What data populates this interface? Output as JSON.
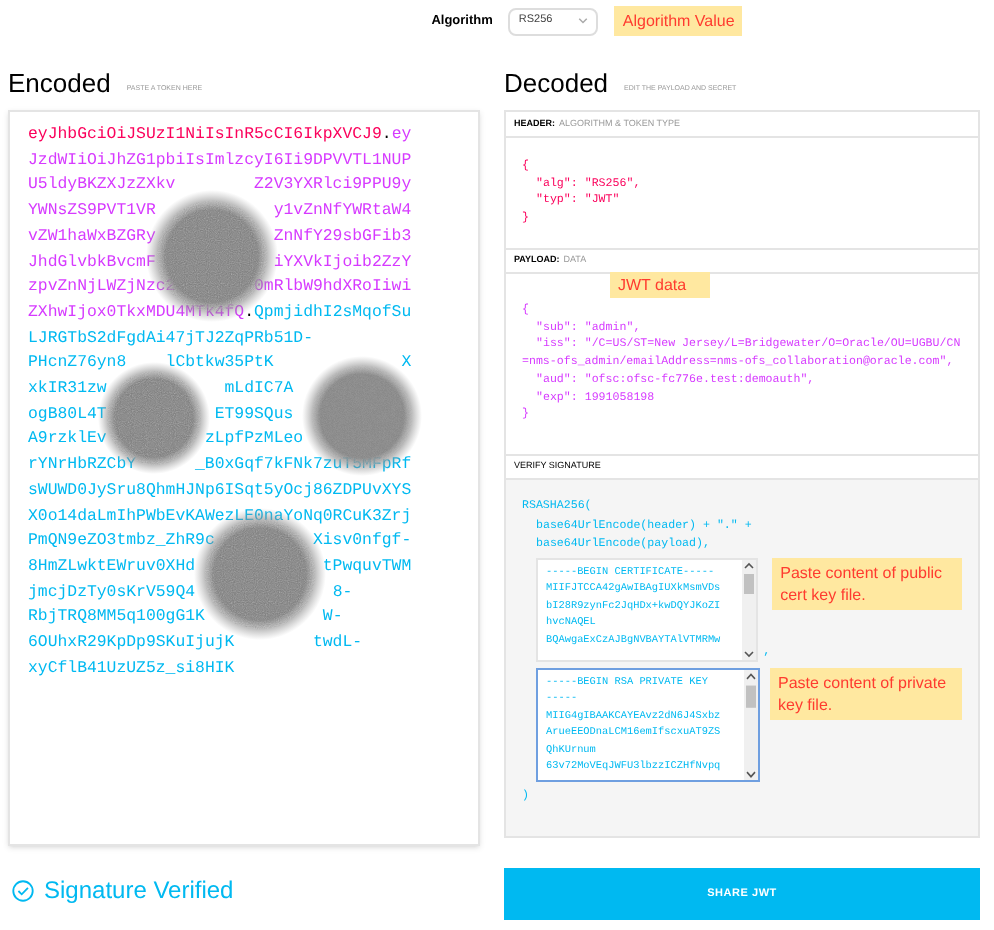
{
  "algorithm": {
    "label": "Algorithm",
    "value": "RS256",
    "note": "Algorithm Value"
  },
  "encoded": {
    "title": "Encoded",
    "subtitle": "PASTE A TOKEN HERE",
    "lines": [
      [
        [
          {
            "kind": "header",
            "text": "eyJhbGciOiJSUzI1NiIsInR5cCI6IkpXVCJ9"
          },
          {
            "kind": "dot",
            "text": "."
          },
          {
            "kind": "payload",
            "text": "ey"
          }
        ]
      ],
      [
        [
          {
            "kind": "payload",
            "text": "JzdWIiOiJhZG1pbiIsImlzcyI6Ii9DPVVTL1NUP"
          }
        ]
      ],
      [
        [
          {
            "kind": "payload",
            "text": "U5ldyBKZXJzZXkv"
          }
        ],
        [
          {
            "kind": "payload",
            "text": "Z2V3YXRlci9PPU9y"
          }
        ]
      ],
      [
        [
          {
            "kind": "payload",
            "text": "YWNsZS9PVT1VR"
          }
        ],
        [
          {
            "kind": "payload",
            "text": "y1vZnNfYWRtaW4"
          }
        ]
      ],
      [
        [
          {
            "kind": "payload",
            "text": "vZW1haWxBZGRy"
          }
        ],
        [
          {
            "kind": "payload",
            "text": "ZnNfY29sbGFib3"
          }
        ]
      ],
      [
        [
          {
            "kind": "payload",
            "text": "JhdGlvbkBvcmF"
          }
        ],
        [
          {
            "kind": "payload",
            "text": "iYXVkIjoib2ZzY"
          }
        ]
      ],
      [
        [
          {
            "kind": "payload",
            "text": "zpvZnNjLWZjNzc2"
          }
        ],
        [
          {
            "kind": "payload",
            "text": "0mRlbW9hdXRoIiwi"
          }
        ]
      ],
      [
        [
          {
            "kind": "payload",
            "text": "ZXhwIjox0TkxMDU4MTk4fQ"
          },
          {
            "kind": "dot",
            "text": "."
          },
          {
            "kind": "signature",
            "text": "QpmjidhI2sMqofSu"
          }
        ]
      ],
      [
        [
          {
            "kind": "signature",
            "text": "LJRGTbS2dFgdAi47jTJ2ZqPRb51D-"
          }
        ]
      ],
      [
        [
          {
            "kind": "signature",
            "text": "PHcnZ76yn8"
          }
        ],
        [
          {
            "kind": "signature",
            "text": "lCbtkw35PtK"
          }
        ],
        [
          {
            "kind": "signature",
            "text": "X"
          }
        ]
      ],
      [
        [
          {
            "kind": "signature",
            "text": "xkIR31zw"
          }
        ],
        [
          {
            "kind": "signature",
            "text": "mLdIC7A"
          }
        ]
      ],
      [
        [
          {
            "kind": "signature",
            "text": "ogB80L4T"
          }
        ],
        [
          {
            "kind": "signature",
            "text": "ET99SQus"
          }
        ]
      ],
      [
        [
          {
            "kind": "signature",
            "text": "A9rzklEv"
          }
        ],
        [
          {
            "kind": "signature",
            "text": "zLpfPzMLeo"
          }
        ]
      ],
      [
        [
          {
            "kind": "signature",
            "text": "rYNrHbRZCbY"
          }
        ],
        [
          {
            "kind": "signature",
            "text": "_B0xGqf7kFNk7zuT5MFpRf"
          }
        ]
      ],
      [
        [
          {
            "kind": "signature",
            "text": "sWUWD0JySru8QhmHJNp6ISqt5yOcj86ZDPUvXYS"
          }
        ]
      ],
      [
        [
          {
            "kind": "signature",
            "text": "X0o14daLmIhPWbEvKAWezLE0naYoNq0RCuK3Zrj"
          }
        ]
      ],
      [
        [
          {
            "kind": "signature",
            "text": "PmQN9eZO3tmbz_ZhR9c"
          }
        ],
        [
          {
            "kind": "signature",
            "text": "Xisv0nfgf-"
          }
        ]
      ],
      [
        [
          {
            "kind": "signature",
            "text": "8HmZLwktEWruv0XHd"
          }
        ],
        [
          {
            "kind": "signature",
            "text": "tPwquvTWM"
          }
        ]
      ],
      [
        [
          {
            "kind": "signature",
            "text": "jmcjDzTy0sKrV59Q4"
          }
        ],
        [
          {
            "kind": "signature",
            "text": "8-"
          }
        ]
      ],
      [
        [
          {
            "kind": "signature",
            "text": "RbjTRQ8MM5q100gG1K"
          }
        ],
        [
          {
            "kind": "signature",
            "text": "W-"
          }
        ]
      ],
      [
        [
          {
            "kind": "signature",
            "text": "6OUhxR29KpDp9SKuIjujK"
          }
        ],
        [
          {
            "kind": "signature",
            "text": "twdL-"
          }
        ]
      ],
      [
        [
          {
            "kind": "signature",
            "text": "xyCflB41UzUZ5z_si8HIK"
          }
        ]
      ]
    ]
  },
  "decoded": {
    "title": "Decoded",
    "subtitle": "EDIT THE PAYLOAD AND SECRET",
    "header": {
      "label": "HEADER:",
      "sublabel": "ALGORITHM & TOKEN TYPE",
      "open": "{",
      "fields": [
        "\"alg\": \"RS256\",",
        "\"typ\": \"JWT\""
      ],
      "close": "}"
    },
    "payload": {
      "label": "PAYLOAD:",
      "sublabel": "DATA",
      "note": "JWT data",
      "open": "{",
      "fields": [
        "\"sub\": \"admin\",",
        "\"iss\": \"/C=US/ST=New Jersey/L=Bridgewater/O=Oracle/OU=UGBU/CN=nms-ofs_admin/emailAddress=nms-ofs_collaboration@oracle.com\",",
        "\"aud\": \"ofsc:ofsc-fc776e.test:demoauth\",",
        "\"exp\": 1991058198"
      ],
      "close": "}"
    },
    "signature": {
      "label": "VERIFY SIGNATURE",
      "lines": [
        "RSASHA256(",
        "base64UrlEncode(header) + \".\" +",
        "base64UrlEncode(payload),"
      ],
      "public_key": {
        "lines": [
          "-----BEGIN CERTIFICATE-----",
          "MIIFJTCCA42gAwIBAgIUXkMsmVDs",
          "bI28R9zynFc2JqHDx+kwDQYJKoZI",
          "hvcNAQEL",
          "BQAwgaExCzAJBgNVBAYTAlVTMRMw"
        ],
        "separator": ",",
        "note": "Paste content of public cert key file.",
        "focused": false
      },
      "private_key": {
        "lines": [
          "-----BEGIN RSA PRIVATE KEY",
          "-----",
          "MIIG4gIBAAKCAYEAvz2dN6J4Sxbz",
          "ArueEEODnaLCM16emIfscxuAT9ZS",
          "QhKUrnum",
          "63v72MoVEqJWFU3lbzzICZHfNvpq"
        ],
        "note": "Paste content of private key file.",
        "focused": true
      },
      "close": ")"
    }
  },
  "status": {
    "text": "Signature Verified",
    "verified": true
  },
  "share_button": "SHARE JWT"
}
